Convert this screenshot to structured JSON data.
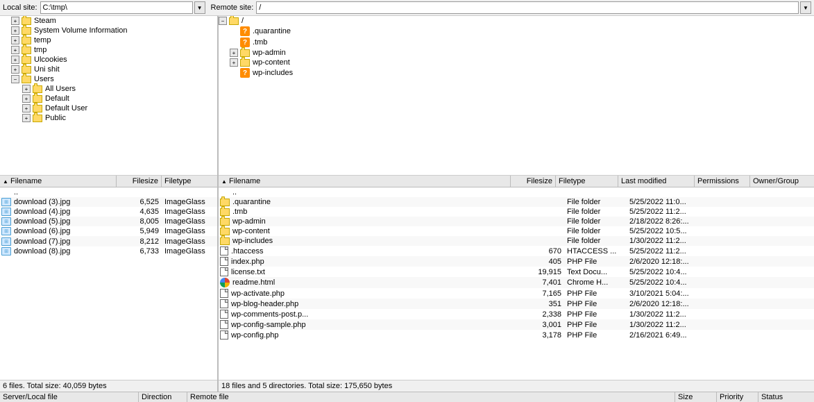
{
  "localSite": {
    "label": "Local site:",
    "value": "C:\\tmp\\"
  },
  "remoteSite": {
    "label": "Remote site:",
    "value": "/"
  },
  "localTree": [
    {
      "id": "steam",
      "label": "Steam",
      "indent": 1,
      "expanded": false,
      "hasChildren": true
    },
    {
      "id": "system-volume",
      "label": "System Volume Information",
      "indent": 1,
      "expanded": false,
      "hasChildren": true
    },
    {
      "id": "temp",
      "label": "temp",
      "indent": 1,
      "expanded": false,
      "hasChildren": true
    },
    {
      "id": "tmp",
      "label": "tmp",
      "indent": 1,
      "expanded": false,
      "hasChildren": true
    },
    {
      "id": "ulcookies",
      "label": "Ulcookies",
      "indent": 1,
      "expanded": false,
      "hasChildren": true
    },
    {
      "id": "uni-shit",
      "label": "Uni shit",
      "indent": 1,
      "expanded": false,
      "hasChildren": true
    },
    {
      "id": "users",
      "label": "Users",
      "indent": 1,
      "expanded": true,
      "hasChildren": true
    },
    {
      "id": "all-users",
      "label": "All Users",
      "indent": 2,
      "expanded": false,
      "hasChildren": true
    },
    {
      "id": "default",
      "label": "Default",
      "indent": 2,
      "expanded": false,
      "hasChildren": true
    },
    {
      "id": "default-user",
      "label": "Default User",
      "indent": 2,
      "expanded": false,
      "hasChildren": true
    },
    {
      "id": "public",
      "label": "Public",
      "indent": 2,
      "expanded": false,
      "hasChildren": true
    }
  ],
  "remoteTree": [
    {
      "id": "root",
      "label": "/",
      "indent": 0,
      "expanded": true,
      "hasChildren": true
    },
    {
      "id": "quarantine",
      "label": ".quarantine",
      "indent": 1,
      "expanded": false,
      "hasChildren": false,
      "unknown": true
    },
    {
      "id": "tmb",
      "label": ".tmb",
      "indent": 1,
      "expanded": false,
      "hasChildren": false,
      "unknown": true
    },
    {
      "id": "wp-admin",
      "label": "wp-admin",
      "indent": 1,
      "expanded": false,
      "hasChildren": true
    },
    {
      "id": "wp-content",
      "label": "wp-content",
      "indent": 1,
      "expanded": false,
      "hasChildren": true
    },
    {
      "id": "wp-includes",
      "label": "wp-includes",
      "indent": 1,
      "expanded": false,
      "hasChildren": false,
      "unknown": true
    }
  ],
  "localFiles": {
    "columns": [
      "Filename",
      "Filesize",
      "Filetype"
    ],
    "statusText": "6 files. Total size: 40,059 bytes",
    "rows": [
      {
        "name": "..",
        "size": "",
        "type": "",
        "icon": "up"
      },
      {
        "name": "download (3).jpg",
        "size": "6,525",
        "type": "ImageGlass",
        "icon": "image"
      },
      {
        "name": "download (4).jpg",
        "size": "4,635",
        "type": "ImageGlass",
        "icon": "image"
      },
      {
        "name": "download (5).jpg",
        "size": "8,005",
        "type": "ImageGlass",
        "icon": "image"
      },
      {
        "name": "download (6).jpg",
        "size": "5,949",
        "type": "ImageGlass",
        "icon": "image"
      },
      {
        "name": "download (7).jpg",
        "size": "8,212",
        "type": "ImageGlass",
        "icon": "image"
      },
      {
        "name": "download (8).jpg",
        "size": "6,733",
        "type": "ImageGlass",
        "icon": "image"
      }
    ]
  },
  "remoteFiles": {
    "columns": [
      "Filename",
      "Filesize",
      "Filetype",
      "Last modified",
      "Permissions",
      "Owner/Group"
    ],
    "statusText": "18 files and 5 directories. Total size: 175,650 bytes",
    "rows": [
      {
        "name": "..",
        "size": "",
        "type": "",
        "modified": "",
        "permissions": "",
        "owner": "",
        "icon": "up"
      },
      {
        "name": ".quarantine",
        "size": "",
        "type": "File folder",
        "modified": "5/25/2022 11:0...",
        "permissions": "",
        "owner": "",
        "icon": "folder"
      },
      {
        "name": ".tmb",
        "size": "",
        "type": "File folder",
        "modified": "5/25/2022 11:2...",
        "permissions": "",
        "owner": "",
        "icon": "folder"
      },
      {
        "name": "wp-admin",
        "size": "",
        "type": "File folder",
        "modified": "2/18/2022 8:26:...",
        "permissions": "",
        "owner": "",
        "icon": "folder"
      },
      {
        "name": "wp-content",
        "size": "",
        "type": "File folder",
        "modified": "5/25/2022 10:5...",
        "permissions": "",
        "owner": "",
        "icon": "folder"
      },
      {
        "name": "wp-includes",
        "size": "",
        "type": "File folder",
        "modified": "1/30/2022 11:2...",
        "permissions": "",
        "owner": "",
        "icon": "folder"
      },
      {
        "name": ".htaccess",
        "size": "670",
        "type": "HTACCESS ...",
        "modified": "5/25/2022 11:2...",
        "permissions": "",
        "owner": "",
        "icon": "file"
      },
      {
        "name": "index.php",
        "size": "405",
        "type": "PHP File",
        "modified": "2/6/2020 12:18:...",
        "permissions": "",
        "owner": "",
        "icon": "file"
      },
      {
        "name": "license.txt",
        "size": "19,915",
        "type": "Text Docu...",
        "modified": "5/25/2022 10:4...",
        "permissions": "",
        "owner": "",
        "icon": "file"
      },
      {
        "name": "readme.html",
        "size": "7,401",
        "type": "Chrome H...",
        "modified": "5/25/2022 10:4...",
        "permissions": "",
        "owner": "",
        "icon": "file-chrome"
      },
      {
        "name": "wp-activate.php",
        "size": "7,165",
        "type": "PHP File",
        "modified": "3/10/2021 5:04:...",
        "permissions": "",
        "owner": "",
        "icon": "file"
      },
      {
        "name": "wp-blog-header.php",
        "size": "351",
        "type": "PHP File",
        "modified": "2/6/2020 12:18:...",
        "permissions": "",
        "owner": "",
        "icon": "file"
      },
      {
        "name": "wp-comments-post.p...",
        "size": "2,338",
        "type": "PHP File",
        "modified": "1/30/2022 11:2...",
        "permissions": "",
        "owner": "",
        "icon": "file"
      },
      {
        "name": "wp-config-sample.php",
        "size": "3,001",
        "type": "PHP File",
        "modified": "1/30/2022 11:2...",
        "permissions": "",
        "owner": "",
        "icon": "file"
      },
      {
        "name": "wp-config.php",
        "size": "3,178",
        "type": "PHP File",
        "modified": "2/16/2021 6:49...",
        "permissions": "",
        "owner": "",
        "icon": "file"
      }
    ]
  },
  "bottomBar": {
    "col1": "Server/Local file",
    "col2": "Direction",
    "col3": "Remote file",
    "col4": "Size",
    "col5": "Priority",
    "col6": "Status"
  }
}
